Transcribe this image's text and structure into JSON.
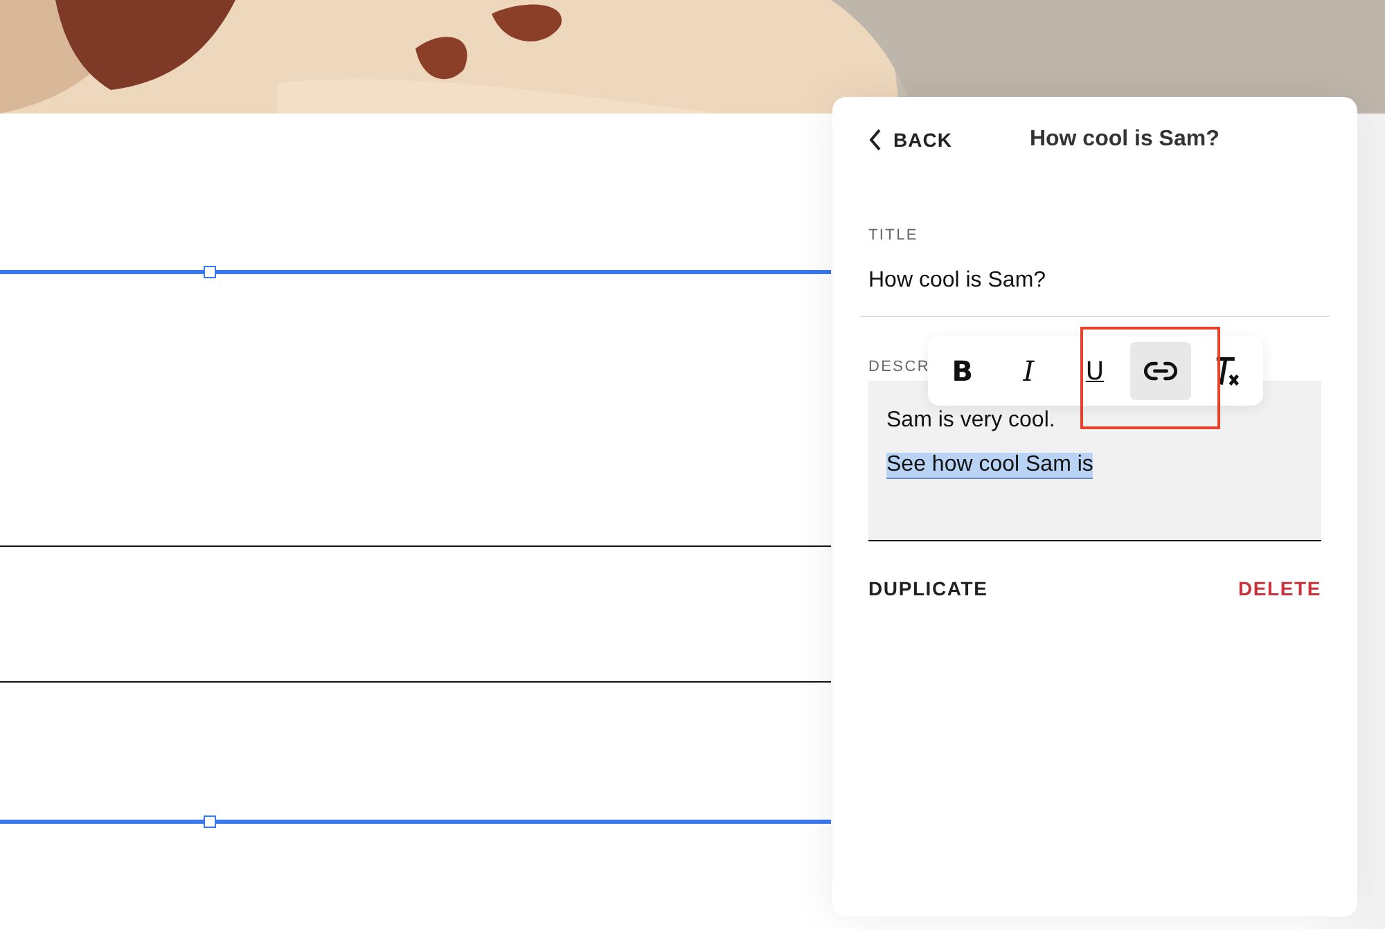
{
  "canvas": {
    "lines": [
      {
        "kind": "selected"
      },
      {
        "kind": "plain"
      },
      {
        "kind": "plain"
      },
      {
        "kind": "selected"
      }
    ]
  },
  "panel": {
    "back": "BACK",
    "title": "How cool is Sam?",
    "title_field": {
      "label": "TITLE",
      "value": "How cool is Sam?"
    },
    "description": {
      "label": "DESCR",
      "lines": [
        {
          "text": "Sam is very cool.",
          "selected": false
        },
        {
          "text": "See how cool Sam is",
          "selected": true
        }
      ]
    },
    "toolbar": [
      {
        "kind": "bold",
        "glyph": "B",
        "selected": false
      },
      {
        "kind": "italic",
        "glyph": "I",
        "selected": false
      },
      {
        "kind": "underline",
        "glyph": "U",
        "selected": false
      },
      {
        "kind": "link",
        "selected": true
      },
      {
        "kind": "clear",
        "selected": false
      }
    ],
    "actions": [
      {
        "label": "DUPLICATE",
        "kind": "neutral"
      },
      {
        "label": "DELETE",
        "kind": "danger"
      }
    ]
  }
}
